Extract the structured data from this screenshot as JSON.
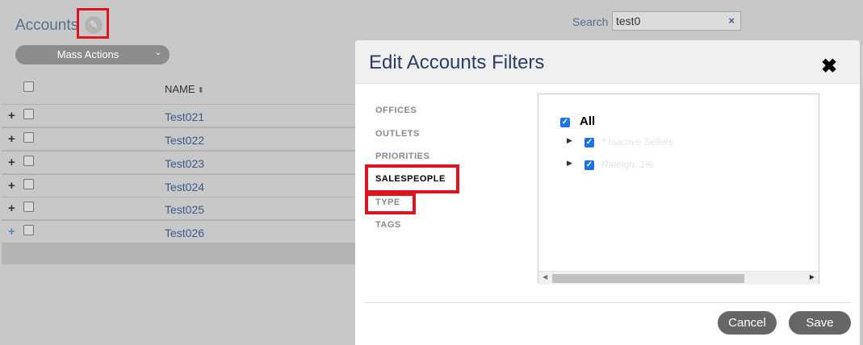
{
  "page": {
    "title": "Accounts"
  },
  "search": {
    "label": "Search",
    "value": "test0",
    "clear_icon": "×"
  },
  "mass_actions": {
    "label": "Mass Actions",
    "chevron": "⌄"
  },
  "table": {
    "column_name": "NAME",
    "sort_icon": "⬍",
    "rows": [
      {
        "expand": "+",
        "name": "Test021"
      },
      {
        "expand": "+",
        "name": "Test022"
      },
      {
        "expand": "+",
        "name": "Test023"
      },
      {
        "expand": "+",
        "name": "Test024"
      },
      {
        "expand": "+",
        "name": "Test025"
      },
      {
        "expand": "+",
        "name": "Test026"
      }
    ]
  },
  "modal": {
    "title": "Edit Accounts Filters",
    "close_icon": "✖",
    "nav": [
      {
        "label": "OFFICES",
        "active": false
      },
      {
        "label": "OUTLETS",
        "active": false
      },
      {
        "label": "PRIORITIES",
        "active": false
      },
      {
        "label": "SALESPEOPLE",
        "active": true
      },
      {
        "label": "TYPE",
        "active": false
      },
      {
        "label": "TAGS",
        "active": false
      }
    ],
    "tree": {
      "all_label": "All",
      "check_glyph": "✓",
      "expand_glyph": "▶",
      "items": [
        {
          "label": "* Inactive Sellers",
          "checked": true
        },
        {
          "label": "Raleigh, 1%",
          "checked": true
        }
      ]
    },
    "scroll": {
      "left_arrow": "◀",
      "right_arrow": "▶"
    },
    "cancel_label": "Cancel",
    "save_label": "Save"
  },
  "colors": {
    "highlight": "#e0141e",
    "link": "#3d5a8a",
    "checkbox": "#1a73e8"
  }
}
